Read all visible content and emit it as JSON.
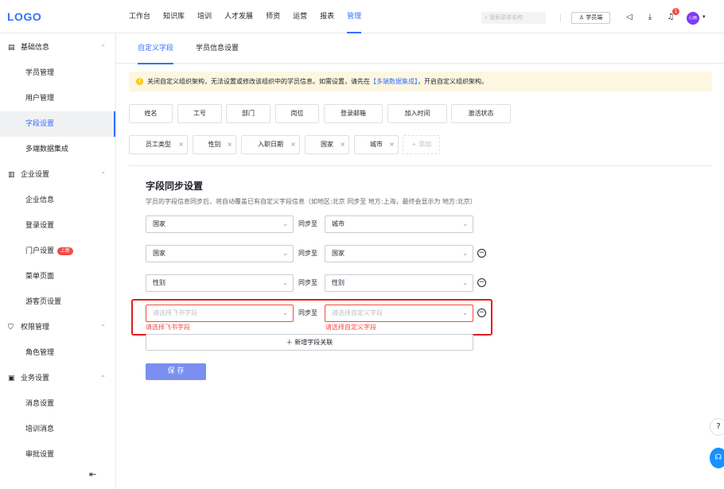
{
  "header": {
    "logo": "LOGO",
    "nav": [
      "工作台",
      "知识库",
      "培训",
      "人才发展",
      "师资",
      "运营",
      "报表",
      "管理"
    ],
    "search_placeholder": "搜索菜单名称",
    "student_button": "学员端",
    "notification_count": "1",
    "avatar_text": "心雨"
  },
  "sidebar": {
    "groups": [
      {
        "label": "基础信息",
        "icon": "book-icon",
        "items": [
          "学员管理",
          "用户管理",
          "字段设置",
          "多端数据集成"
        ]
      },
      {
        "label": "企业设置",
        "icon": "building-icon",
        "items": [
          "企业信息",
          "登录设置",
          "门户设置",
          "菜单页面",
          "游客页设置"
        ]
      },
      {
        "label": "权限管理",
        "icon": "shield-icon",
        "items": [
          "角色管理"
        ]
      },
      {
        "label": "业务设置",
        "icon": "image-icon",
        "items": [
          "消息设置",
          "培训消息",
          "审批设置"
        ]
      }
    ],
    "portal_badge": "上新"
  },
  "tabs": [
    "自定义字段",
    "学员信息设置"
  ],
  "notice": {
    "text_before": "关闭自定义组织架构，无法设置或修改该组织中的学员信息。如需设置，请先在",
    "link": "【多端数据集成】",
    "text_after": "，开启自定义组织架构。"
  },
  "fixed_fields": [
    "姓名",
    "工号",
    "部门",
    "岗位",
    "登录邮箱",
    "加入时间",
    "激活状态"
  ],
  "custom_fields": [
    "员工类型",
    "性别",
    "入职日期",
    "国家",
    "城市"
  ],
  "add_field_label": "+ 添加",
  "sync": {
    "title": "字段同步设置",
    "description": "学员的字段信息同步后，将自动覆盖已有自定义字段信息（如地区:北京 同步至 地方:上海，最终会显示为 地方:北京）",
    "sync_label": "同步至",
    "rows": [
      {
        "source": "国家",
        "target": "城市",
        "removable": false
      },
      {
        "source": "国家",
        "target": "国家",
        "removable": true
      },
      {
        "source": "性别",
        "target": "性别",
        "removable": true
      }
    ],
    "empty_row": {
      "source_placeholder": "请选择飞书字段",
      "target_placeholder": "请选择自定义字段",
      "source_error": "请选择飞书字段",
      "target_error": "请选择自定义字段"
    },
    "add_row_label": "新增字段关联",
    "save_label": "保 存"
  },
  "colors": {
    "accent": "#3370ff",
    "error": "#f54a45",
    "notice_bg": "#fdf7e1",
    "save_bg": "#7b8ff0"
  }
}
